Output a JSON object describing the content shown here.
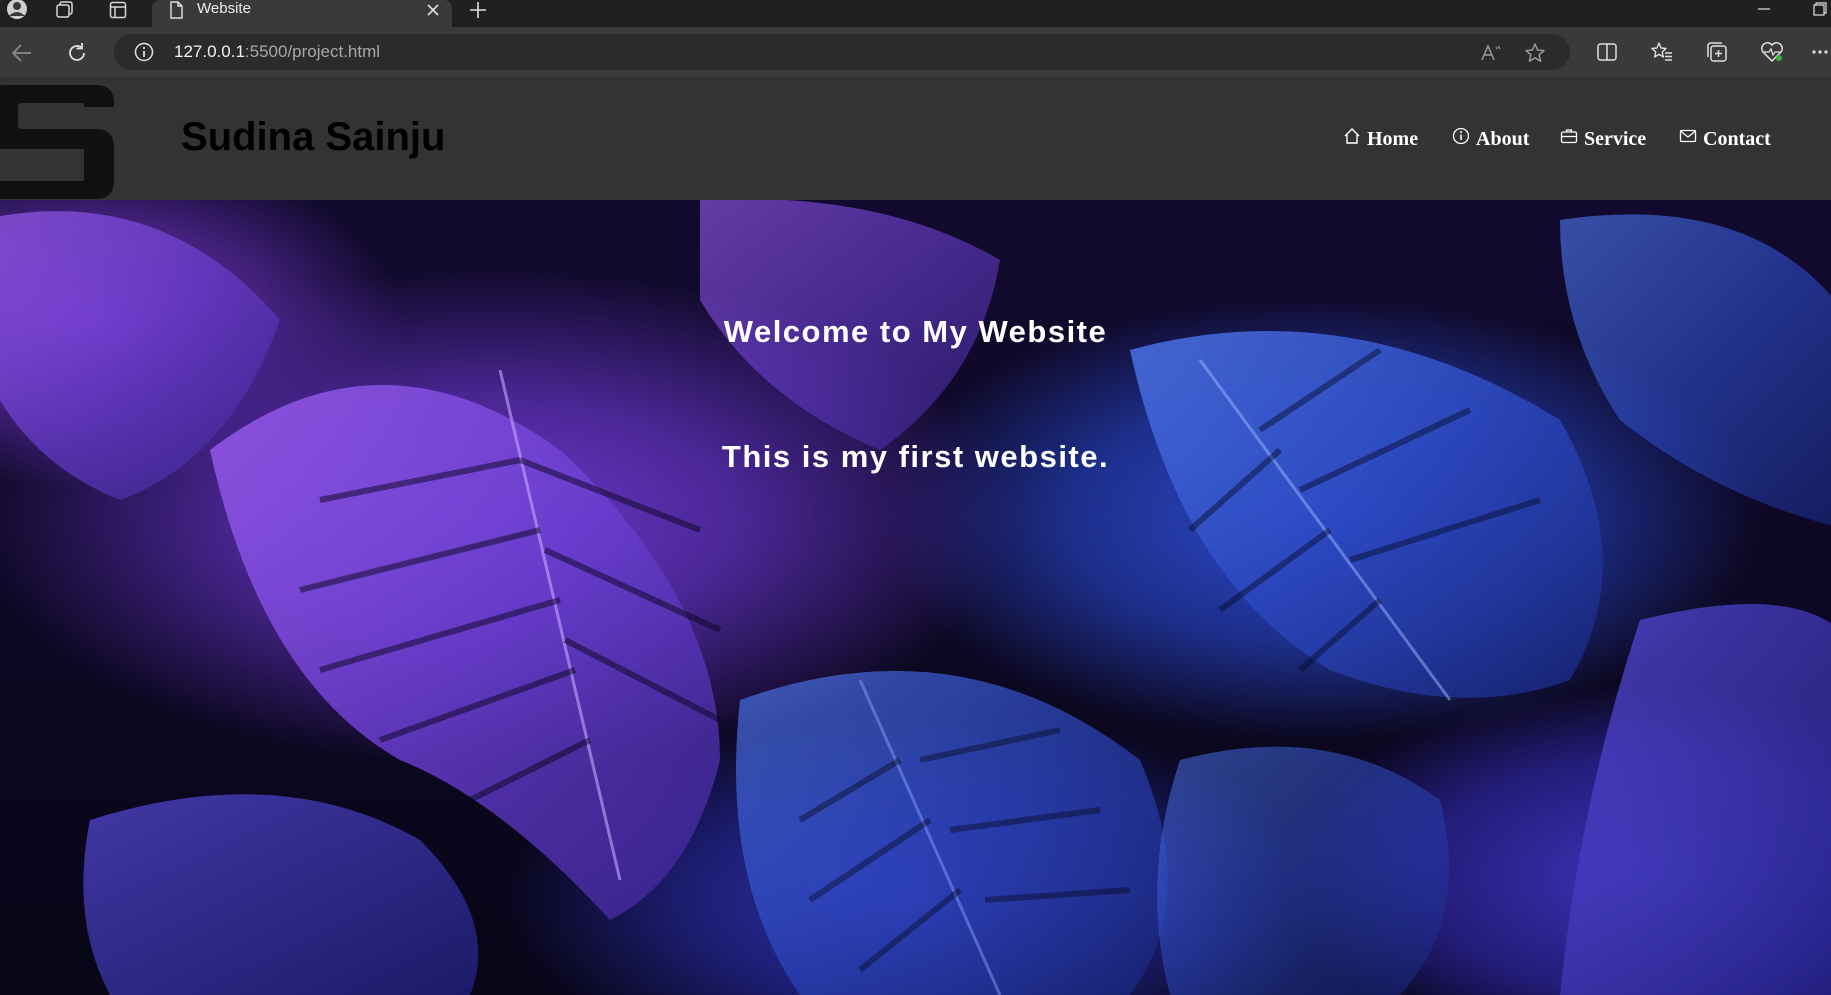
{
  "browser": {
    "tab_title": "Website",
    "url_host": "127.0.0.1",
    "url_path": ":5500/project.html"
  },
  "site": {
    "name": "Sudina Sainju",
    "nav": [
      {
        "label": "Home",
        "icon": "home-icon"
      },
      {
        "label": "About",
        "icon": "info-icon"
      },
      {
        "label": "Service",
        "icon": "briefcase-icon"
      },
      {
        "label": "Contact",
        "icon": "envelope-icon"
      }
    ]
  },
  "hero": {
    "title": "Welcome to My Website",
    "subtitle": "This is my first website."
  },
  "colors": {
    "header_bg": "#333333",
    "nav_text": "#ffffff",
    "site_name": "#000000",
    "hero_text": "#ffffff"
  }
}
